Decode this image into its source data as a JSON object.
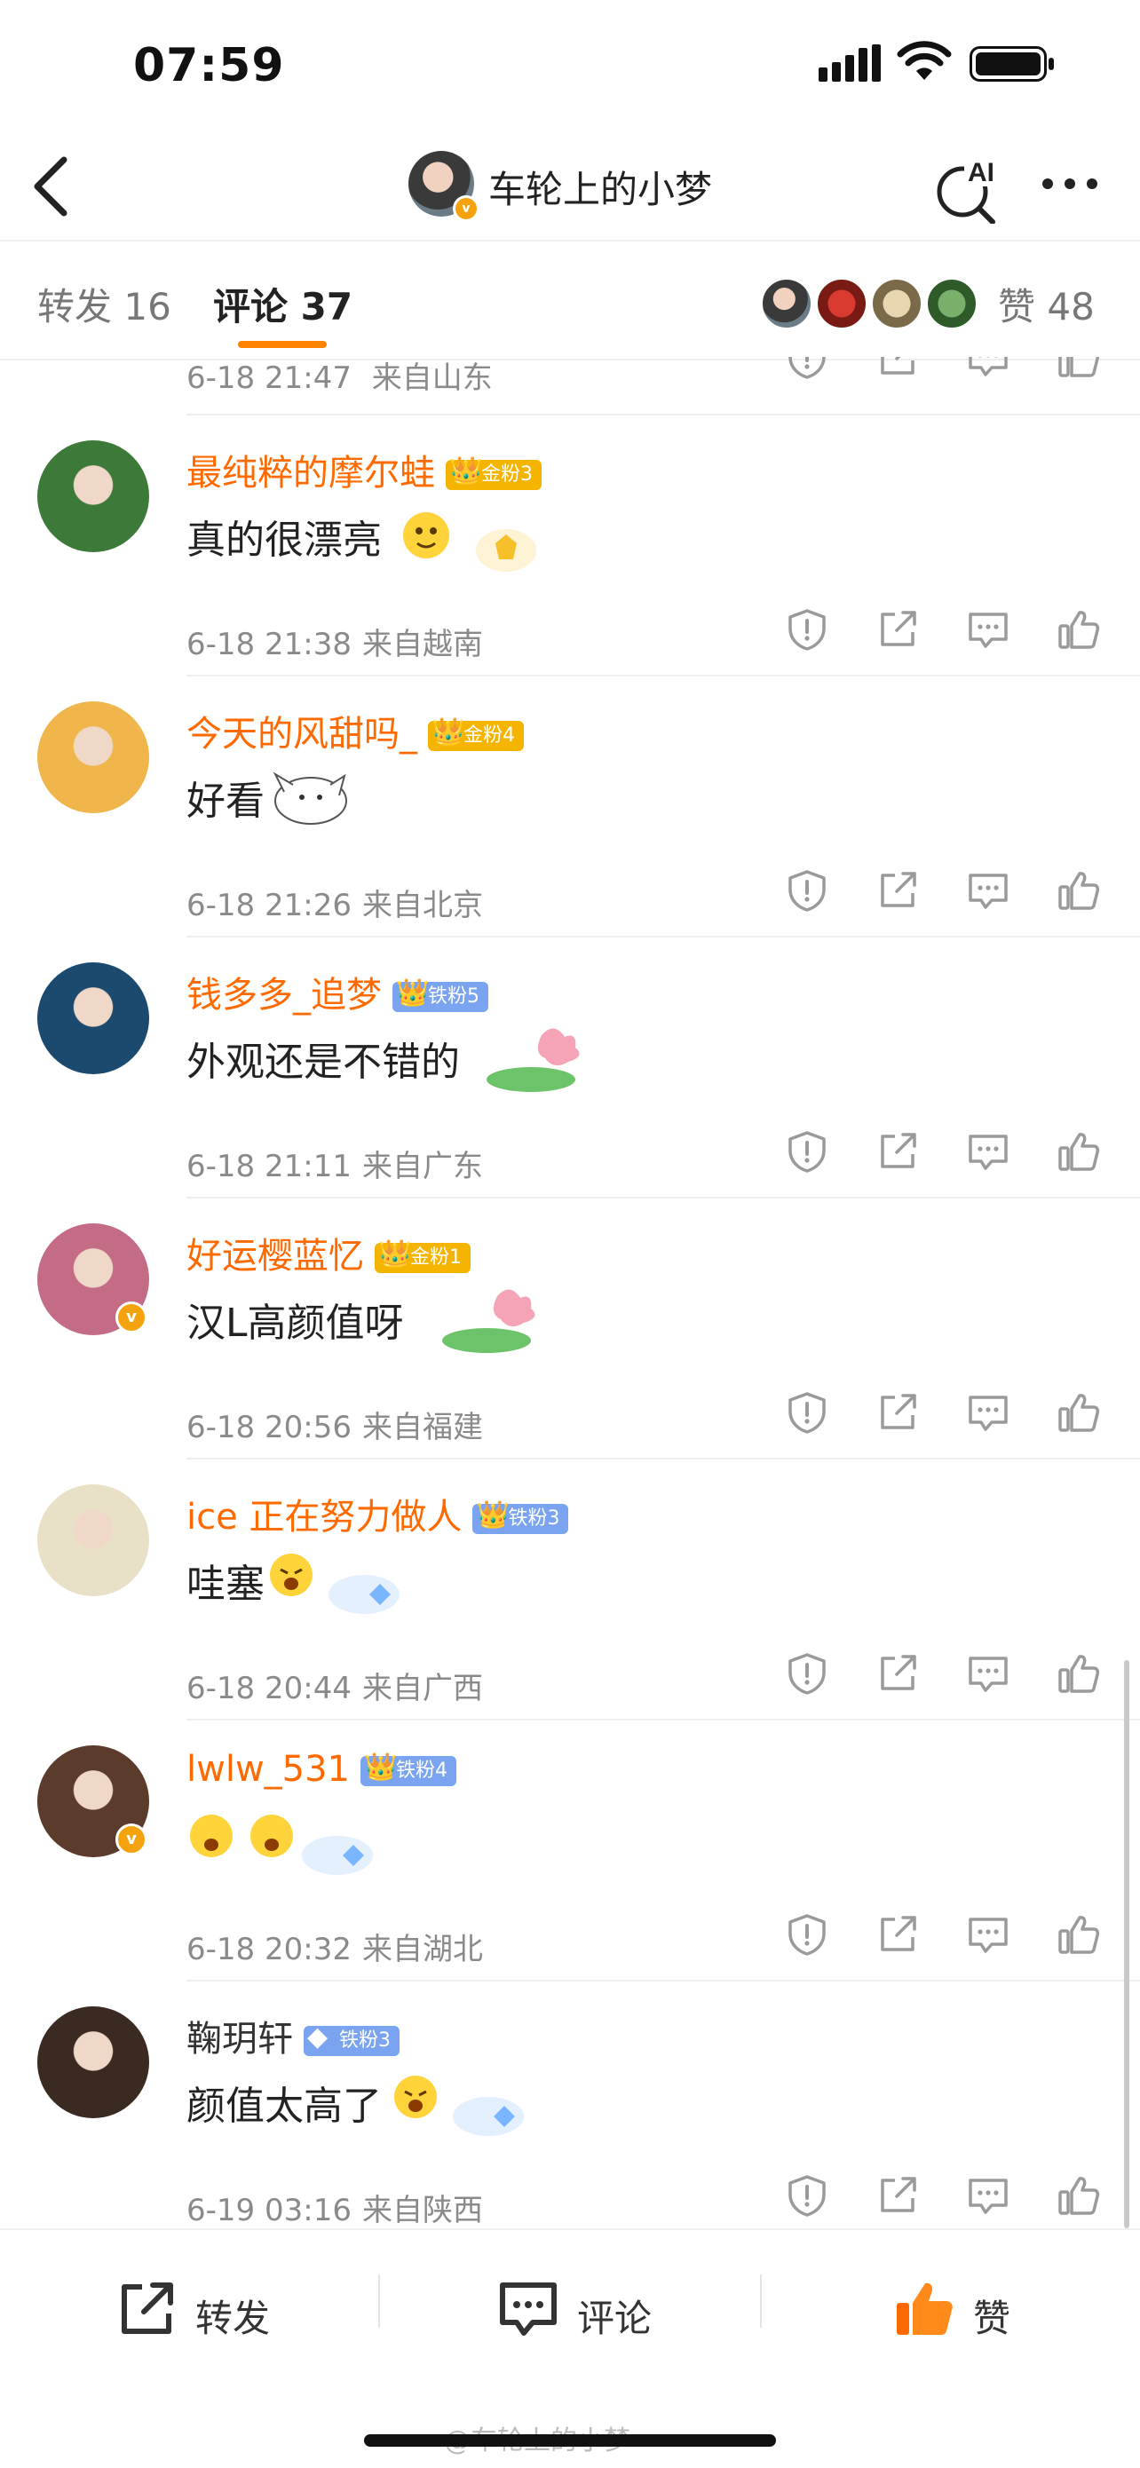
{
  "status_bar": {
    "time": "07:59"
  },
  "header": {
    "title": "车轮上的小梦",
    "ai_label": "AI"
  },
  "tabs": {
    "forward": "转发 16",
    "comment": "评论 37",
    "likes": "赞 48"
  },
  "comments_partial": {
    "time": "6-18 21:47",
    "location": "来自山东"
  },
  "comments": [
    {
      "name": "最纯粹的摩尔蛙",
      "badge": "金粉3",
      "badge_level": "4",
      "text": "真的很漂亮",
      "time": "6-18 21:38",
      "location": "来自越南",
      "avatar_color": "#3d7a3a",
      "verified": false
    },
    {
      "name": "今天的风甜吗_",
      "badge": "金粉4",
      "badge_level": "5",
      "text": "好看",
      "time": "6-18 21:26",
      "location": "来自北京",
      "avatar_color": "#f1b64b",
      "verified": false
    },
    {
      "name": "钱多多_追梦",
      "badge": "铁粉5",
      "badge_level": "5",
      "text": "外观还是不错的",
      "time": "6-18 21:11",
      "location": "来自广东",
      "avatar_color": "#1c4a6e",
      "verified": false
    },
    {
      "name": "好运樱蓝忆",
      "badge": "金粉1",
      "badge_level": "4",
      "text": "汉L高颜值呀",
      "time": "6-18 20:56",
      "location": "来自福建",
      "avatar_color": "#c46b86",
      "verified": true
    },
    {
      "name": "ice 正在努力做人",
      "badge": "铁粉3",
      "badge_level": "2",
      "text": "哇塞",
      "time": "6-18 20:44",
      "location": "来自广西",
      "avatar_color": "#e9e0c8",
      "verified": false
    },
    {
      "name": "lwlw_531",
      "badge": "铁粉4",
      "badge_level": "4",
      "text": "",
      "time": "6-18 20:32",
      "location": "来自湖北",
      "avatar_color": "#5a3b2c",
      "verified": true
    },
    {
      "name": "鞠玥轩",
      "badge": "铁粉3",
      "badge_level": "",
      "text": "颜值太高了",
      "time": "6-19 03:16",
      "location": "来自陕西",
      "avatar_color": "#3a2a22",
      "verified": false,
      "gray_name": true
    }
  ],
  "bottom_bar": {
    "forward": "转发",
    "comment": "评论",
    "like": "赞"
  },
  "watermark": "@车轮上的小梦",
  "colors": {
    "accent": "#ff8200",
    "name": "#ff6a00",
    "gold_badge": "#f5b400",
    "iron_badge": "#7aa3f0"
  }
}
